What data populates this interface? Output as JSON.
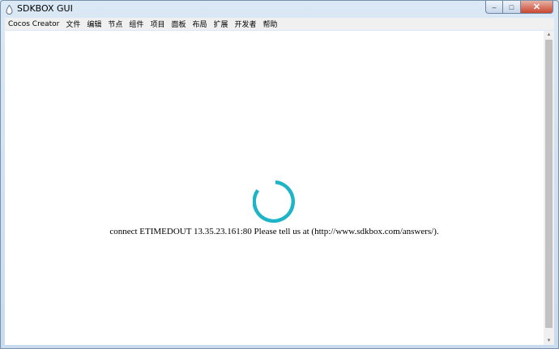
{
  "window": {
    "title": "SDKBOX GUI",
    "controls": {
      "minimize": "–",
      "maximize": "□",
      "close": "✕"
    }
  },
  "menubar": {
    "items": [
      "Cocos Creator",
      "文件",
      "编辑",
      "节点",
      "组件",
      "项目",
      "面板",
      "布局",
      "扩展",
      "开发者",
      "帮助"
    ]
  },
  "content": {
    "status_message": "connect ETIMEDOUT 13.35.23.161:80 Please tell us at (http://www.sdkbox.com/answers/).",
    "spinner_color": "#1eb4c8"
  },
  "icons": {
    "app": "app-drop-icon",
    "spinner": "loading-spinner-icon"
  }
}
